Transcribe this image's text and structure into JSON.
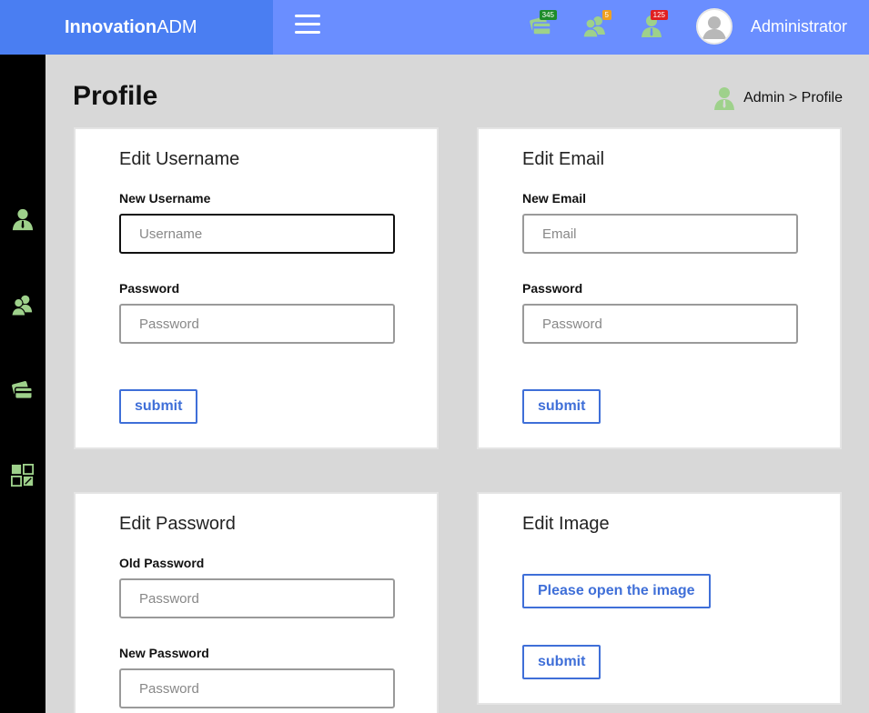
{
  "header": {
    "brand_bold": "Innovation",
    "brand_rest": "ADM",
    "notifications": [
      {
        "icon": "card-icon",
        "count": "345",
        "color": "#1e8c2a"
      },
      {
        "icon": "users-icon",
        "count": "5",
        "color": "#f0a020"
      },
      {
        "icon": "user-icon",
        "count": "125",
        "color": "#e02020"
      }
    ],
    "user_name": "Administrator"
  },
  "sidebar": {
    "items": [
      "user-icon",
      "users-icon",
      "card-icon",
      "dashboard-icon"
    ]
  },
  "page": {
    "title": "Profile",
    "breadcrumb": "Admin > Profile"
  },
  "cards": {
    "username": {
      "title": "Edit Username",
      "field1_label": "New Username",
      "field1_placeholder": "Username",
      "field2_label": "Password",
      "field2_placeholder": "Password",
      "submit": "submit"
    },
    "email": {
      "title": "Edit Email",
      "field1_label": "New Email",
      "field1_placeholder": "Email",
      "field2_label": "Password",
      "field2_placeholder": "Password",
      "submit": "submit"
    },
    "password": {
      "title": "Edit Password",
      "field1_label": "Old Password",
      "field1_placeholder": "Password",
      "field2_label": "New Password",
      "field2_placeholder": "Password"
    },
    "image": {
      "title": "Edit Image",
      "open_button": "Please open the image",
      "submit": "submit"
    }
  },
  "colors": {
    "brand_bg": "#4a7ef2",
    "topbar_bg": "#6a8eff",
    "icon_green": "#9ed18b",
    "button_blue": "#3f6fd8"
  }
}
